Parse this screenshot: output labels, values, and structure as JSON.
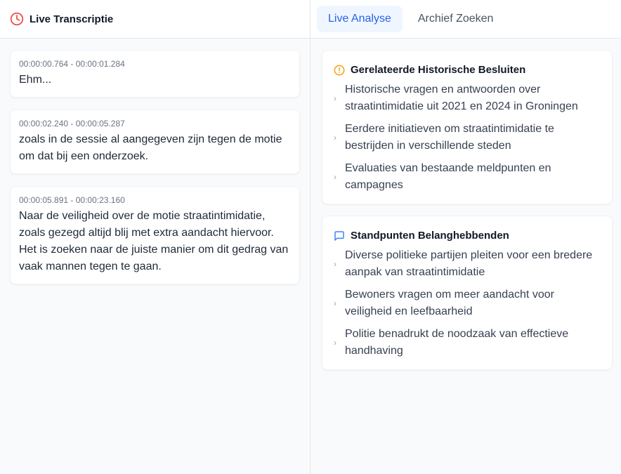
{
  "left": {
    "title": "Live Transcriptie",
    "segments": [
      {
        "time": "00:00:00.764 - 00:00:01.284",
        "text": "Ehm..."
      },
      {
        "time": "00:00:02.240 - 00:00:05.287",
        "text": "zoals in de sessie al aangegeven zijn tegen de motie om dat bij een onderzoek."
      },
      {
        "time": "00:00:05.891 - 00:00:23.160",
        "text": "Naar de veiligheid over de motie straatintimidatie, zoals gezegd altijd blij met extra aandacht hiervoor. Het is zoeken naar de juiste manier om dit gedrag van vaak mannen tegen te gaan."
      }
    ]
  },
  "tabs": [
    {
      "label": "Live Analyse",
      "active": true
    },
    {
      "label": "Archief Zoeken",
      "active": false
    }
  ],
  "panels": [
    {
      "title": "Gerelateerde Historische Besluiten",
      "icon": "alert-circle-icon",
      "icon_color": "#f59e0b",
      "items": [
        "Historische vragen en antwoorden over straatintimidatie uit 2021 en 2024 in Groningen",
        "Eerdere initiatieven om straatintimidatie te bestrijden in verschillende steden",
        "Evaluaties van bestaande meldpunten en campagnes"
      ]
    },
    {
      "title": "Standpunten Belanghebbenden",
      "icon": "message-square-icon",
      "icon_color": "#3b82f6",
      "items": [
        "Diverse politieke partijen pleiten voor een bredere aanpak van straatintimidatie",
        "Bewoners vragen om meer aandacht voor veiligheid en leefbaarheid",
        "Politie benadrukt de noodzaak van effectieve handhaving"
      ]
    }
  ],
  "colors": {
    "clock": "#ef4444",
    "accent": "#2563eb",
    "active_tab_bg": "#eff6ff"
  }
}
